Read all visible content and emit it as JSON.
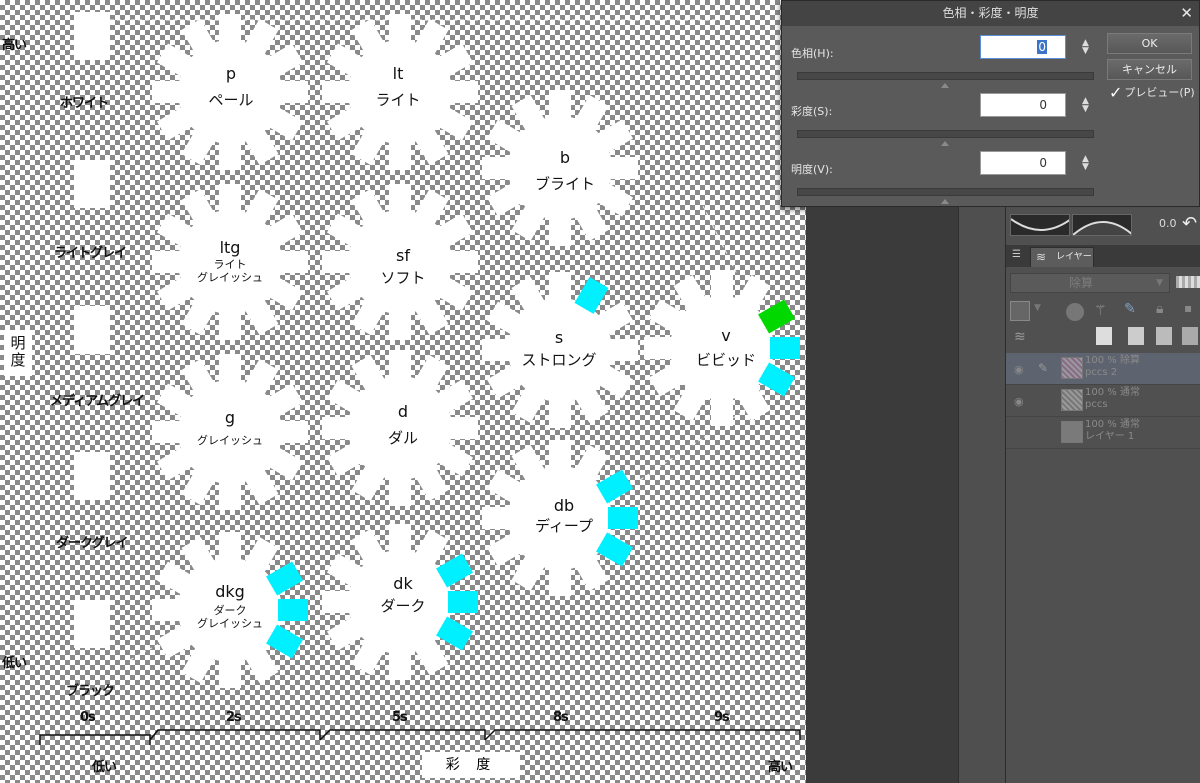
{
  "canvas": {
    "value_labels": [
      "高い",
      "ホワイト",
      "ライトグレイ",
      "メディアムグレイ",
      "ダークグレイ",
      "低い",
      "ブラック"
    ],
    "brightness_axis": "明\n度",
    "saturation_ticks": [
      "0s",
      "2s",
      "5s",
      "8s",
      "9s"
    ],
    "saturation_low": "低い",
    "saturation_axis": "彩 度",
    "saturation_high": "高い",
    "tones": [
      {
        "code": "p",
        "name": "ペール"
      },
      {
        "code": "lt",
        "name": "ライト"
      },
      {
        "code": "b",
        "name": "ブライト"
      },
      {
        "code": "ltg",
        "name": "ライト\nグレイッシュ"
      },
      {
        "code": "sf",
        "name": "ソフト"
      },
      {
        "code": "s",
        "name": "ストロング"
      },
      {
        "code": "v",
        "name": "ビビッド"
      },
      {
        "code": "g",
        "name": "グレイッシュ"
      },
      {
        "code": "d",
        "name": "ダル"
      },
      {
        "code": "db",
        "name": "ディープ"
      },
      {
        "code": "dkg",
        "name": "ダーク\nグレイッシュ"
      },
      {
        "code": "dk",
        "name": "ダーク"
      }
    ],
    "colors": {
      "cyan": "#00f0ff",
      "green": "#00d800",
      "white": "#ffffff"
    }
  },
  "dialog": {
    "title": "色相・彩度・明度",
    "hue_label": "色相(H):",
    "hue_value": "0",
    "saturation_label": "彩度(S):",
    "saturation_value": "0",
    "value_label": "明度(V):",
    "value_value": "0",
    "ok_label": "OK",
    "cancel_label": "キャンセル",
    "preview_label": "プレビュー(P)",
    "preview_checked": true
  },
  "panel": {
    "curve_value": "0.0",
    "layer_tab_label": "レイヤー",
    "blend_mode": "除算",
    "layers": [
      {
        "line1": "100 % 除算",
        "line2": "pccs 2",
        "selected": true
      },
      {
        "line1": "100 % 通常",
        "line2": "pccs",
        "selected": false
      },
      {
        "line1": "100 % 通常",
        "line2": "レイヤー 1",
        "selected": false
      }
    ]
  }
}
